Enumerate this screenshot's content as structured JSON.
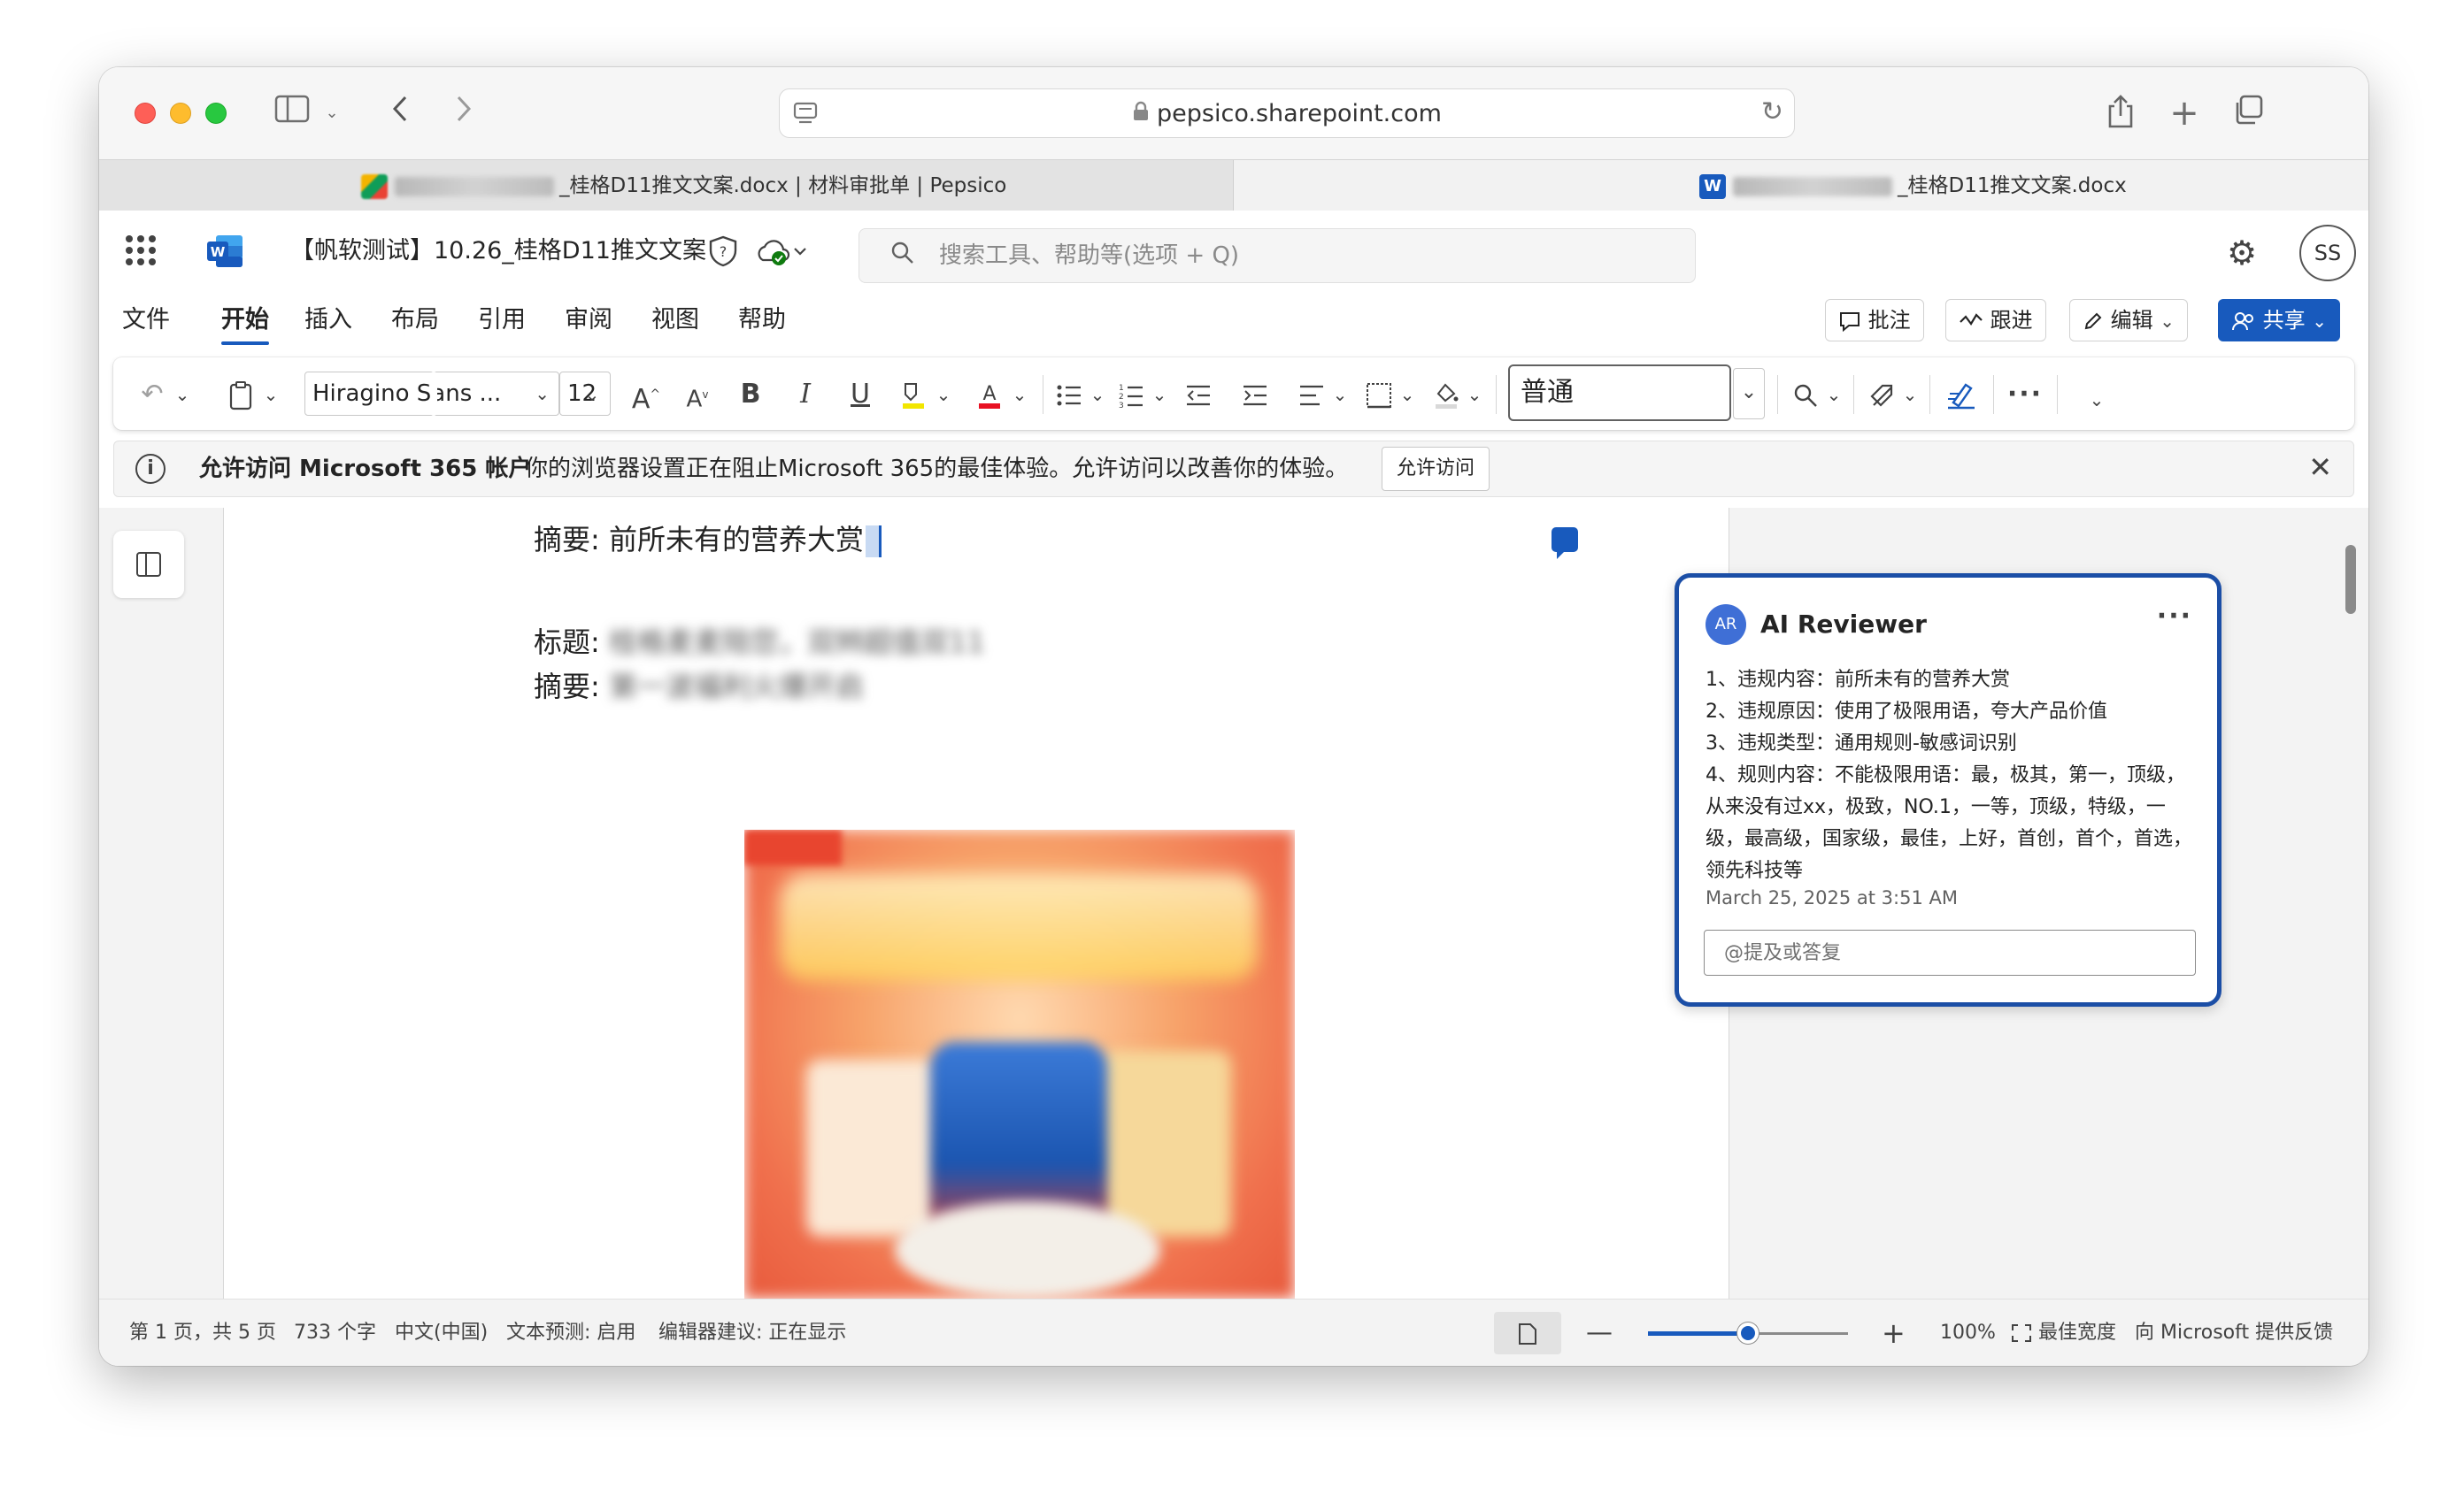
{
  "browser": {
    "url": "pepsico.sharepoint.com",
    "tabs": [
      {
        "label": "_桂格D11推文文案.docx | 材料审批单 | Pepsico",
        "active": false
      },
      {
        "label": "_桂格D11推文文案.docx",
        "active": true
      }
    ]
  },
  "word": {
    "doc_title": "【帆软测试】10.26_桂格D11推文文案",
    "search_placeholder": "搜索工具、帮助等(选项 + Q)",
    "user_initials": "SS",
    "menu_tabs": [
      "文件",
      "开始",
      "插入",
      "布局",
      "引用",
      "审阅",
      "视图",
      "帮助"
    ],
    "active_tab": "开始",
    "header_buttons": {
      "comments": "批注",
      "track": "跟进",
      "edit": "编辑",
      "share": "共享"
    },
    "ribbon": {
      "font_name": "Hiragino Sans ...",
      "font_size": "12",
      "style": "普通"
    },
    "infobar": {
      "title": "允许访问 Microsoft 365 帐户",
      "message": "你的浏览器设置正在阻止Microsoft 365的最佳体验。允许访问以改善你的体验。",
      "button": "允许访问"
    }
  },
  "document": {
    "line1_label": "摘要:",
    "line1_text": "前所未有的营养大赏",
    "line2_label": "标题:",
    "line2_text": "桂格麦麦陪您，双辫超值双11",
    "line3_label": "摘要:",
    "line3_text": "第一波福利火爆开启"
  },
  "comment": {
    "avatar": "AR",
    "author": "AI Reviewer",
    "lines": [
      "1、违规内容：前所未有的营养大赏",
      "2、违规原因：使用了极限用语，夸大产品价值",
      "3、违规类型：通用规则-敏感词识别",
      "4、规则内容：不能极限用语：最，极其，第一，顶级，从来没有过xx，极致，NO.1，一等，顶级，特级，一级，最高级，国家级，最佳，上好，首创，首个，首选，领先科技等"
    ],
    "date": "March 25, 2025 at 3:51 AM",
    "reply_placeholder": "@提及或答复"
  },
  "status": {
    "page": "第 1 页，共 5 页",
    "words": "733 个字",
    "language": "中文(中国)",
    "prediction": "文本预测: 启用",
    "editor": "编辑器建议: 正在显示",
    "zoom": "100%",
    "zoom_fraction": 0.5,
    "fit": "最佳宽度",
    "feedback": "向 Microsoft 提供反馈"
  },
  "colors": {
    "accent": "#185abd",
    "comment_border": "#1b4ea6"
  }
}
